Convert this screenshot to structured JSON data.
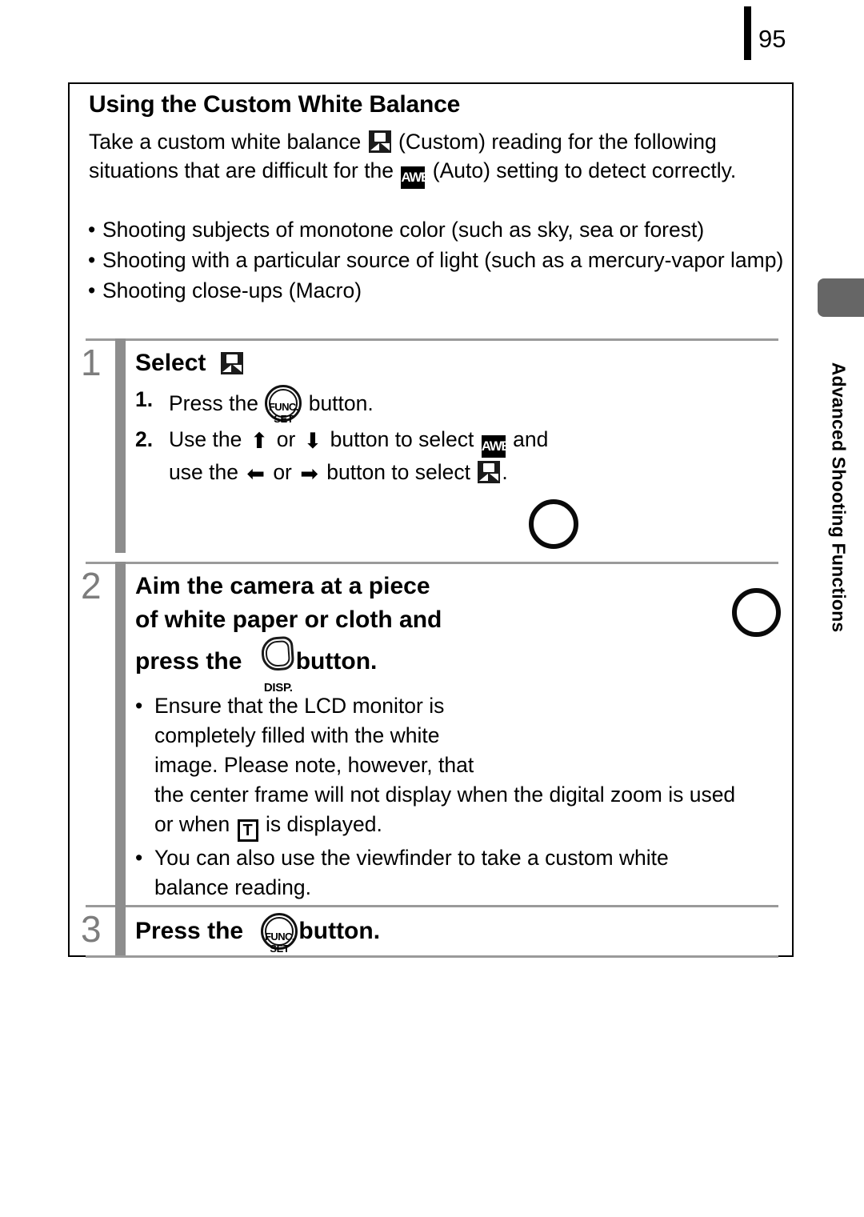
{
  "page": {
    "number": "95",
    "side_tab_label": "Advanced Shooting Functions"
  },
  "section": {
    "title": "Using the Custom White Balance",
    "intro": {
      "part1": "Take a custom white balance",
      "icon1": "custom-white-balance-icon",
      "part2": "(Custom) reading for the following situations that are difficult for the",
      "icon2": "auto-white-balance-icon",
      "part3": "(Auto) setting to detect correctly."
    },
    "bullets": [
      "Shooting subjects of monotone color (such as sky, sea or forest)",
      "Shooting with a particular source of light (such as a mercury-vapor lamp)",
      "Shooting close-ups (Macro)"
    ]
  },
  "steps": [
    {
      "number": "1",
      "heading": "Select",
      "heading_icon": "custom-white-balance-icon",
      "substeps": [
        {
          "marker": "1.",
          "text_a": "Press the",
          "icon": "func-set-button-icon",
          "text_b": "button."
        },
        {
          "marker": "2.",
          "text_a": "Use the",
          "arrow_up": "⬆",
          "text_b": "or",
          "arrow_down": "⬇",
          "text_c": "button to select",
          "icon_awb": "auto-white-balance-icon",
          "text_d": "and use the",
          "arrow_left": "⬅",
          "text_e": "or",
          "arrow_right": "➡",
          "text_f": "button to select",
          "icon_wb": "custom-white-balance-icon",
          "text_g": "."
        }
      ]
    },
    {
      "number": "2",
      "heading_line1": "Aim the camera at a piece",
      "heading_line2": "of white paper or cloth and",
      "heading_line3_a": "press the",
      "heading_icon": "disp-button-icon",
      "heading_icon_label": "DISP.",
      "heading_line3_b": "button.",
      "bullets": [
        {
          "lines": [
            "Ensure that the LCD monitor is",
            "completely filled with the white",
            "image. Please note, however, that",
            "the center frame will not display when the digital zoom is used",
            "or when"
          ],
          "icon": "tele-zoom-icon",
          "icon_text": "T",
          "tail": "is displayed."
        },
        {
          "lines": [
            "You can also use the viewfinder to take a custom white",
            "balance reading."
          ]
        }
      ]
    },
    {
      "number": "3",
      "heading_a": "Press the",
      "heading_icon": "func-set-button-icon",
      "heading_b": "button."
    }
  ],
  "colors": {
    "step_number": "#7d7d7d",
    "step_bar": "#8d8d8d",
    "rule": "#9a9a9a",
    "side_tab_block": "#666666",
    "icon_dark": "#1b1b1b"
  }
}
